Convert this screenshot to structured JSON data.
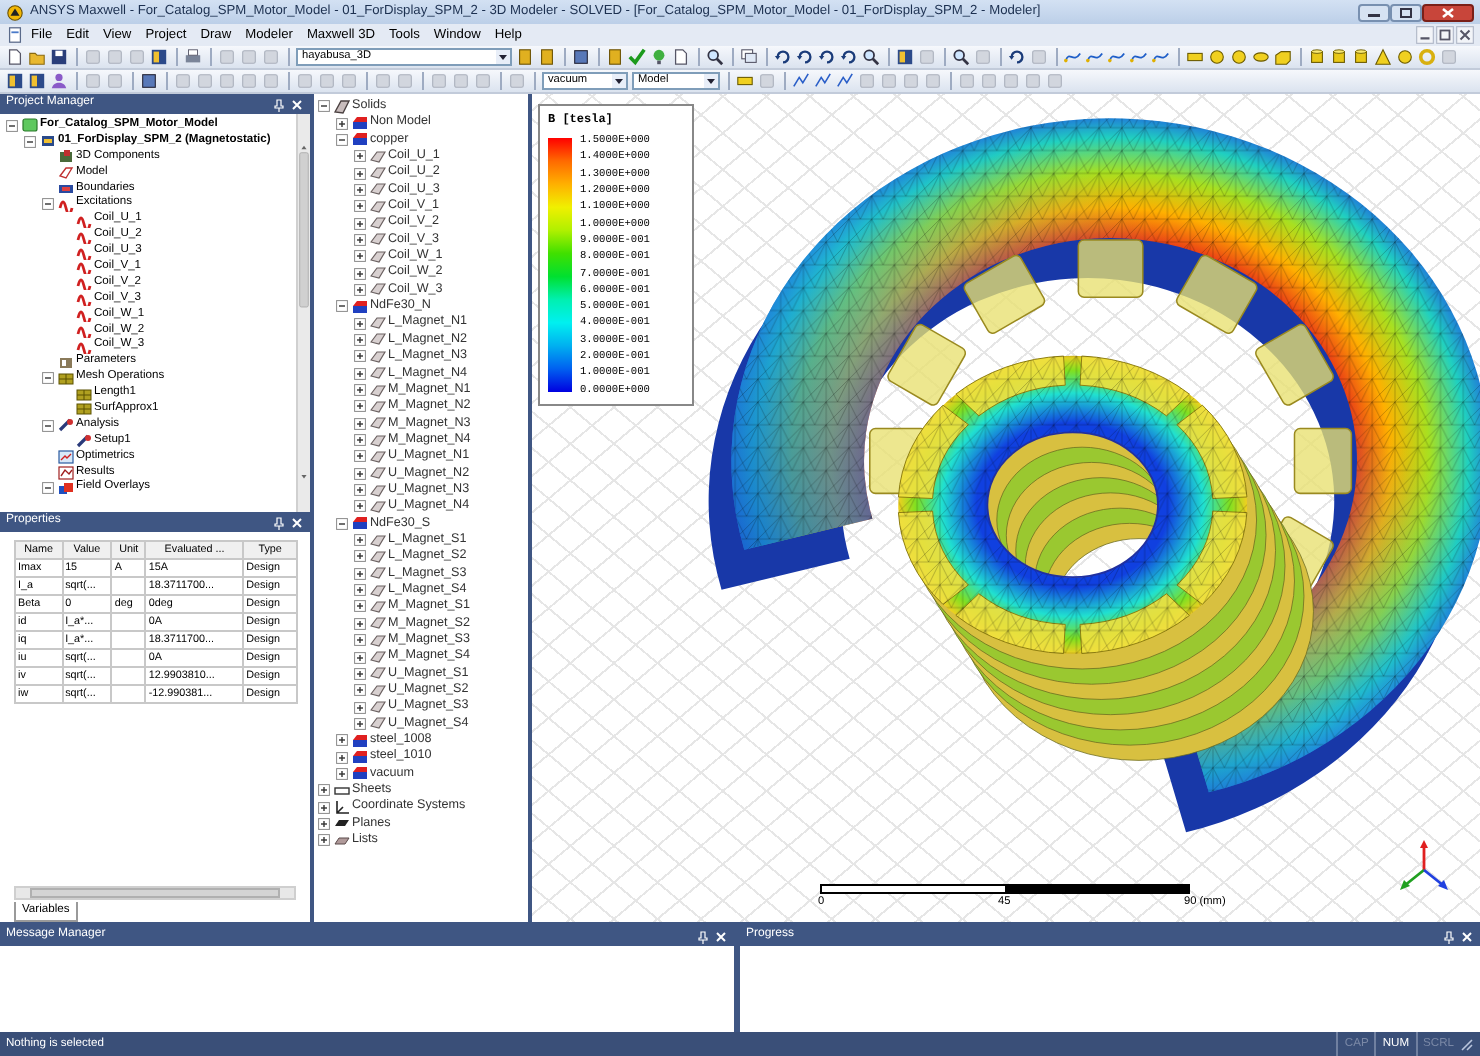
{
  "window": {
    "title": "ANSYS Maxwell - For_Catalog_SPM_Motor_Model - 01_ForDisplay_SPM_2 - 3D Modeler - SOLVED - [For_Catalog_SPM_Motor_Model - 01_ForDisplay_SPM_2 - Modeler]"
  },
  "menu": [
    "File",
    "Edit",
    "View",
    "Project",
    "Draw",
    "Modeler",
    "Maxwell 3D",
    "Tools",
    "Window",
    "Help"
  ],
  "toolbar": {
    "project_combo": "hayabusa_3D",
    "material_combo": "vacuum",
    "view_combo": "Model"
  },
  "project_manager": {
    "title": "Project Manager",
    "tree": [
      {
        "label": "For_Catalog_SPM_Motor_Model",
        "kind": "project",
        "expanded": true,
        "children": [
          {
            "label": "01_ForDisplay_SPM_2 (Magnetostatic)",
            "kind": "design",
            "expanded": true,
            "children": [
              {
                "label": "3D Components",
                "kind": "component"
              },
              {
                "label": "Model",
                "kind": "model"
              },
              {
                "label": "Boundaries",
                "kind": "boundary"
              },
              {
                "label": "Excitations",
                "kind": "excitation",
                "expanded": true,
                "children": [
                  {
                    "label": "Coil_U_1",
                    "kind": "excitation"
                  },
                  {
                    "label": "Coil_U_2",
                    "kind": "excitation"
                  },
                  {
                    "label": "Coil_U_3",
                    "kind": "excitation"
                  },
                  {
                    "label": "Coil_V_1",
                    "kind": "excitation"
                  },
                  {
                    "label": "Coil_V_2",
                    "kind": "excitation"
                  },
                  {
                    "label": "Coil_V_3",
                    "kind": "excitation"
                  },
                  {
                    "label": "Coil_W_1",
                    "kind": "excitation"
                  },
                  {
                    "label": "Coil_W_2",
                    "kind": "excitation"
                  },
                  {
                    "label": "Coil_W_3",
                    "kind": "excitation"
                  }
                ]
              },
              {
                "label": "Parameters",
                "kind": "parameter"
              },
              {
                "label": "Mesh Operations",
                "kind": "mesh",
                "expanded": true,
                "children": [
                  {
                    "label": "Length1",
                    "kind": "mesh"
                  },
                  {
                    "label": "SurfApprox1",
                    "kind": "mesh"
                  }
                ]
              },
              {
                "label": "Analysis",
                "kind": "analysis",
                "expanded": true,
                "children": [
                  {
                    "label": "Setup1",
                    "kind": "analysis"
                  }
                ]
              },
              {
                "label": "Optimetrics",
                "kind": "optimetrics"
              },
              {
                "label": "Results",
                "kind": "results"
              },
              {
                "label": "Field Overlays",
                "kind": "overlay",
                "expanded": true
              }
            ]
          }
        ]
      }
    ]
  },
  "properties": {
    "title": "Properties",
    "columns": [
      "Name",
      "Value",
      "Unit",
      "Evaluated ...",
      "Type"
    ],
    "rows": [
      [
        "Imax",
        "15",
        "A",
        "15A",
        "Design"
      ],
      [
        "I_a",
        "sqrt(...",
        "",
        "18.3711700...",
        "Design"
      ],
      [
        "Beta",
        "0",
        "deg",
        "0deg",
        "Design"
      ],
      [
        "id",
        "I_a*...",
        "",
        "0A",
        "Design"
      ],
      [
        "iq",
        "I_a*...",
        "",
        "18.3711700...",
        "Design"
      ],
      [
        "iu",
        "sqrt(...",
        "",
        "0A",
        "Design"
      ],
      [
        "iv",
        "sqrt(...",
        "",
        "12.9903810...",
        "Design"
      ],
      [
        "iw",
        "sqrt(...",
        "",
        "-12.990381...",
        "Design"
      ]
    ],
    "tabs": [
      {
        "label": "Variables",
        "selected": true
      }
    ]
  },
  "model_tree": [
    {
      "label": "Solids",
      "kind": "group",
      "expanded": true,
      "children": [
        {
          "label": "Non Model",
          "kind": "material",
          "expanded": false
        },
        {
          "label": "copper",
          "kind": "material",
          "expanded": true,
          "children": [
            {
              "label": "Coil_U_1",
              "expanded": false
            },
            {
              "label": "Coil_U_2",
              "expanded": false
            },
            {
              "label": "Coil_U_3",
              "expanded": false
            },
            {
              "label": "Coil_V_1",
              "expanded": false
            },
            {
              "label": "Coil_V_2",
              "expanded": false
            },
            {
              "label": "Coil_V_3",
              "expanded": false
            },
            {
              "label": "Coil_W_1",
              "expanded": false
            },
            {
              "label": "Coil_W_2",
              "expanded": false
            },
            {
              "label": "Coil_W_3",
              "expanded": false
            }
          ]
        },
        {
          "label": "NdFe30_N",
          "kind": "material",
          "expanded": true,
          "children": [
            {
              "label": "L_Magnet_N1",
              "expanded": false
            },
            {
              "label": "L_Magnet_N2",
              "expanded": false
            },
            {
              "label": "L_Magnet_N3",
              "expanded": false
            },
            {
              "label": "L_Magnet_N4",
              "expanded": false
            },
            {
              "label": "M_Magnet_N1",
              "expanded": false
            },
            {
              "label": "M_Magnet_N2",
              "expanded": false
            },
            {
              "label": "M_Magnet_N3",
              "expanded": false
            },
            {
              "label": "M_Magnet_N4",
              "expanded": false
            },
            {
              "label": "U_Magnet_N1",
              "expanded": false
            },
            {
              "label": "U_Magnet_N2",
              "expanded": false
            },
            {
              "label": "U_Magnet_N3",
              "expanded": false
            },
            {
              "label": "U_Magnet_N4",
              "expanded": false
            }
          ]
        },
        {
          "label": "NdFe30_S",
          "kind": "material",
          "expanded": true,
          "children": [
            {
              "label": "L_Magnet_S1",
              "expanded": false
            },
            {
              "label": "L_Magnet_S2",
              "expanded": false
            },
            {
              "label": "L_Magnet_S3",
              "expanded": false
            },
            {
              "label": "L_Magnet_S4",
              "expanded": false
            },
            {
              "label": "M_Magnet_S1",
              "expanded": false
            },
            {
              "label": "M_Magnet_S2",
              "expanded": false
            },
            {
              "label": "M_Magnet_S3",
              "expanded": false
            },
            {
              "label": "M_Magnet_S4",
              "expanded": false
            },
            {
              "label": "U_Magnet_S1",
              "expanded": false
            },
            {
              "label": "U_Magnet_S2",
              "expanded": false
            },
            {
              "label": "U_Magnet_S3",
              "expanded": false
            },
            {
              "label": "U_Magnet_S4",
              "expanded": false
            }
          ]
        },
        {
          "label": "steel_1008",
          "kind": "material",
          "expanded": false
        },
        {
          "label": "steel_1010",
          "kind": "material",
          "expanded": false
        },
        {
          "label": "vacuum",
          "kind": "material",
          "expanded": false
        }
      ]
    },
    {
      "label": "Sheets",
      "kind": "sheets",
      "expanded": false
    },
    {
      "label": "Coordinate Systems",
      "kind": "coords",
      "expanded": false
    },
    {
      "label": "Planes",
      "kind": "planes",
      "expanded": false
    },
    {
      "label": "Lists",
      "kind": "lists",
      "expanded": false
    }
  ],
  "legend": {
    "title": "B [tesla]",
    "entries": [
      "1.5000E+000",
      "1.4000E+000",
      "1.3000E+000",
      "1.2000E+000",
      "1.1000E+000",
      "1.0000E+000",
      "9.0000E-001",
      "8.0000E-001",
      "7.0000E-001",
      "6.0000E-001",
      "5.0000E-001",
      "4.0000E-001",
      "3.0000E-001",
      "2.0000E-001",
      "1.0000E-001",
      "0.0000E+000"
    ]
  },
  "scale_bar": {
    "labels": [
      "0",
      "45",
      "90 (mm)"
    ]
  },
  "message_manager": {
    "title": "Message Manager"
  },
  "progress": {
    "title": "Progress"
  },
  "status_bar": {
    "text": "Nothing is selected",
    "indicators": [
      {
        "label": "CAP",
        "on": false
      },
      {
        "label": "NUM",
        "on": true
      },
      {
        "label": "SCRL",
        "on": false
      }
    ]
  }
}
